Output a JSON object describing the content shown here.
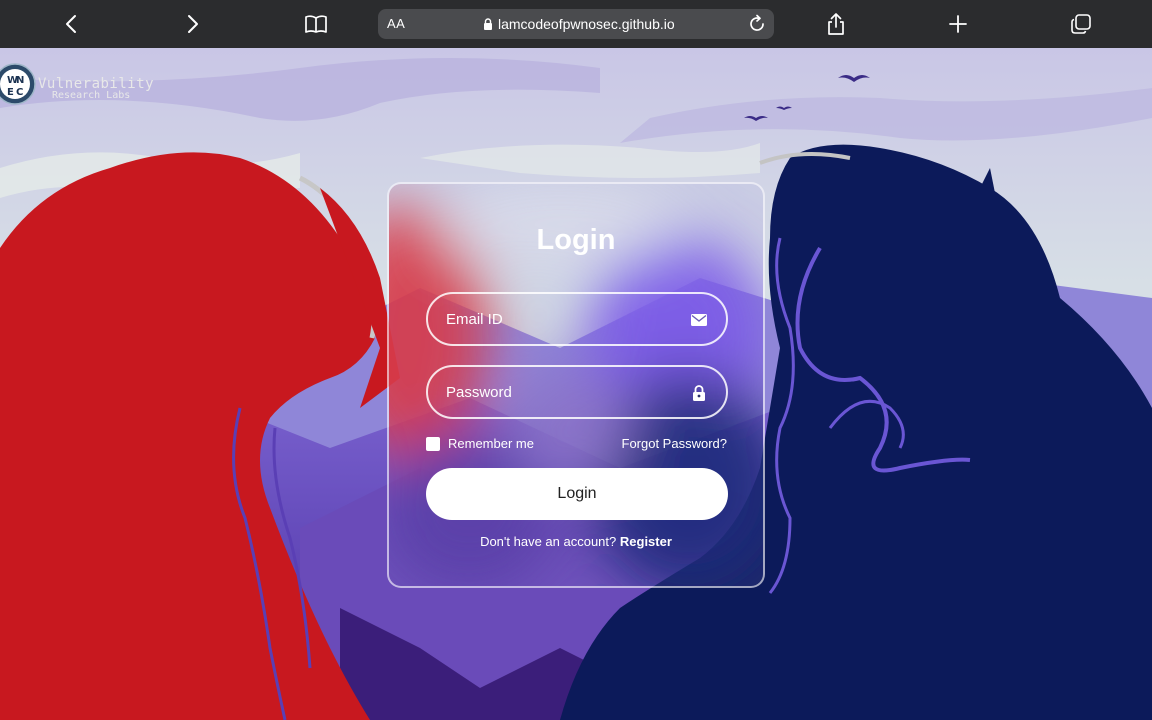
{
  "browser": {
    "back_icon": "chevron-left-icon",
    "forward_icon": "chevron-right-icon",
    "reader_icon": "book-icon",
    "aa_label": "AA",
    "url": "lamcodeofpwnosec.github.io",
    "share_icon": "share-icon",
    "new_tab_icon": "plus-icon",
    "tabs_icon": "tabs-icon"
  },
  "site": {
    "logo_letters": [
      "W",
      "N",
      "E",
      "C"
    ],
    "brand_line1": "Vulnerability",
    "brand_line2": "Research Labs"
  },
  "login": {
    "title": "Login",
    "email_placeholder": "Email ID",
    "password_placeholder": "Password",
    "remember_label": "Remember me",
    "forgot_label": "Forgot Password?",
    "submit_label": "Login",
    "no_account_text": "Don't have an account?",
    "register_label": "Register"
  },
  "colors": {
    "toolbar": "#2b2c2e",
    "red_figure": "#c8181f",
    "navy_figure": "#0c1a5a",
    "sky": "#cfd6e8",
    "mountain": "#5a44b8"
  }
}
